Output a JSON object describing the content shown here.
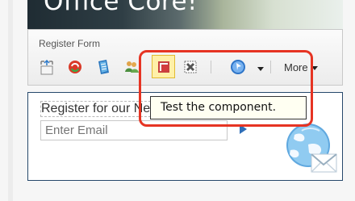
{
  "banner": {
    "title": "Office Core!"
  },
  "panel": {
    "title": "Register Form",
    "more_label": "More"
  },
  "tools": [
    {
      "name": "move-icon"
    },
    {
      "name": "refresh-icon"
    },
    {
      "name": "document-icon"
    },
    {
      "name": "users-icon"
    },
    {
      "name": "test-component-icon"
    },
    {
      "name": "delete-icon"
    },
    {
      "name": "navigation-icon"
    }
  ],
  "preview": {
    "heading": "Register for our Newsletter",
    "email_placeholder": "Enter Email"
  },
  "tooltip": {
    "text": "Test the component."
  },
  "colors": {
    "highlight": "#e63423",
    "preview_border": "#26486b",
    "tooltip_bg": "#fffff2"
  }
}
